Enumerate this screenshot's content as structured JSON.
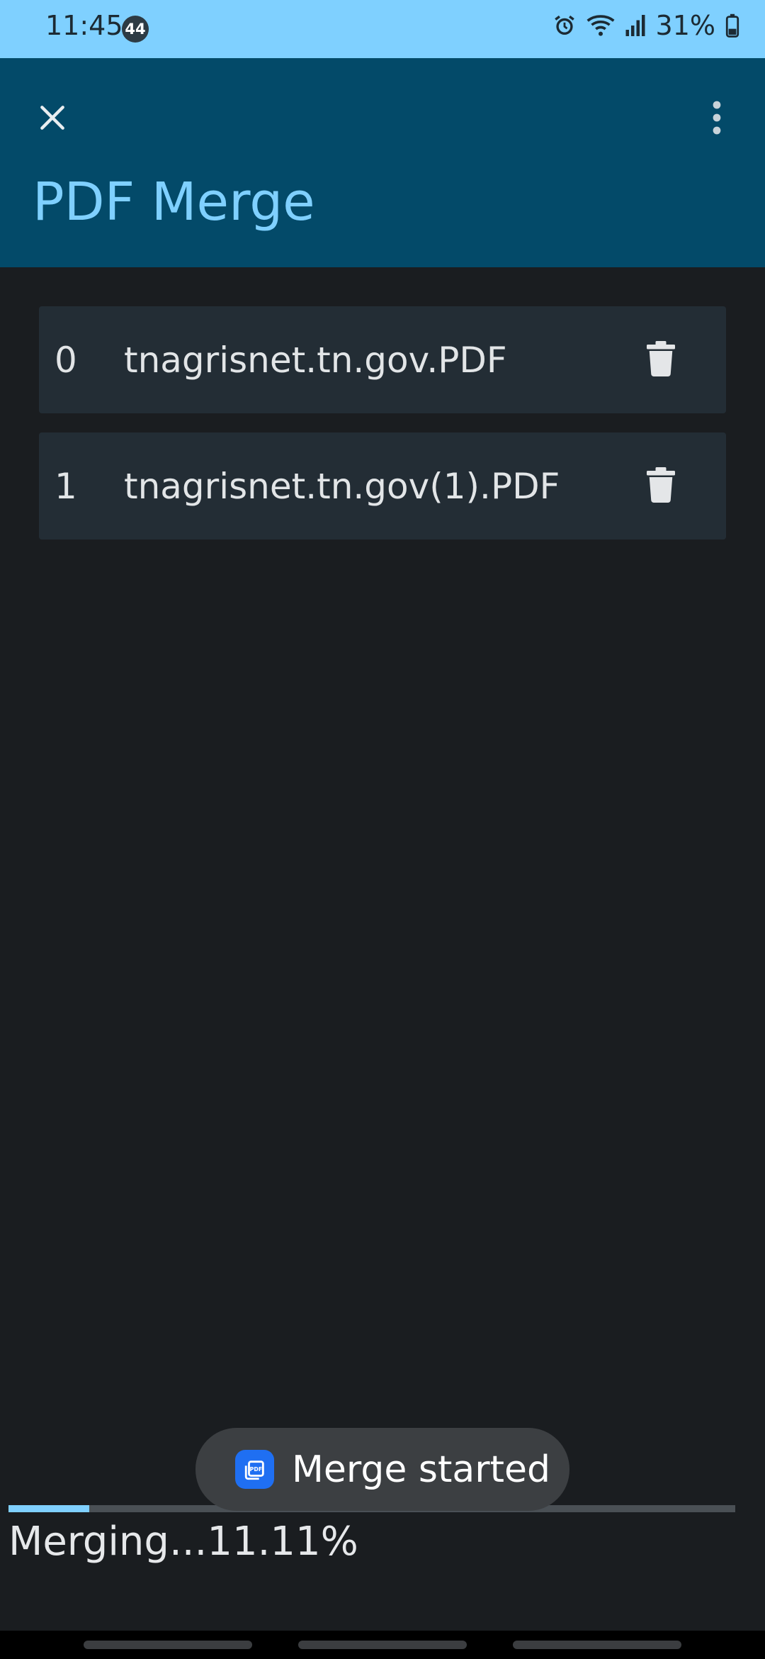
{
  "status_bar": {
    "time": "11:45",
    "notification_count": "44",
    "battery": "31%",
    "icons": [
      "alarm-icon",
      "wifi-icon",
      "signal-icon",
      "battery-icon"
    ]
  },
  "app_bar": {
    "title": "PDF Merge",
    "close_icon": "close-icon",
    "menu_icon": "more-vert-icon",
    "background_color": "#034a69",
    "title_color": "#7fd0ff"
  },
  "files": [
    {
      "index": "0",
      "name": "tnagrisnet.tn.gov.PDF",
      "action_icon": "delete-icon"
    },
    {
      "index": "1",
      "name": "tnagrisnet.tn.gov(1).PDF",
      "action_icon": "delete-icon"
    }
  ],
  "toast": {
    "text": "Merge started",
    "icon": "pdf-app-icon",
    "icon_label": "PDF"
  },
  "progress": {
    "percent": 11.11,
    "label": "Merging...11.11%",
    "accent_color": "#7fd0ff"
  }
}
